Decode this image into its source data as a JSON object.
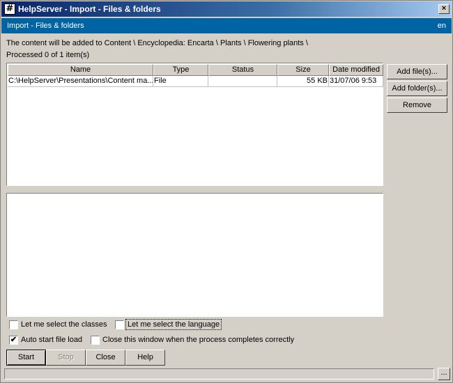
{
  "window": {
    "title": "HelpServer - Import - Files & folders",
    "app_icon": "#",
    "close_label": "×"
  },
  "header": {
    "title": "Import - Files & folders",
    "language": "en"
  },
  "info": {
    "target_path": "The content will be added to Content \\ Encyclopedia: Encarta \\ Plants \\ Flowering plants \\",
    "processed": "Processed 0 of 1 item(s)"
  },
  "table": {
    "columns": [
      "Name",
      "Type",
      "Status",
      "Size",
      "Date modified"
    ],
    "rows": [
      {
        "name": "C:\\HelpServer\\Presentations\\Content ma...",
        "type": "File",
        "status": "",
        "size": "55 KB",
        "date": "31/07/06 9:53"
      }
    ]
  },
  "side_buttons": {
    "add_files": "Add file(s)...",
    "add_folders": "Add folder(s)...",
    "remove": "Remove"
  },
  "options": {
    "select_classes": {
      "label": "Let me select the classes",
      "checked": false
    },
    "select_language": {
      "label": "Let me select the language",
      "checked": false
    },
    "auto_start": {
      "label": "Auto start file load",
      "checked": true
    },
    "close_on_complete": {
      "label": "Close this window when the process completes correctly",
      "checked": false
    },
    "check_mark": "✔"
  },
  "buttons": {
    "start": "Start",
    "stop": "Stop",
    "close": "Close",
    "help": "Help"
  },
  "status_bar": {
    "more_label": "..."
  },
  "icons": {
    "app": "app-icon",
    "close": "close-icon"
  },
  "colors": {
    "header_band": "#0063a3",
    "title_gradient_start": "#0a246a",
    "face": "#d4d0c8"
  }
}
